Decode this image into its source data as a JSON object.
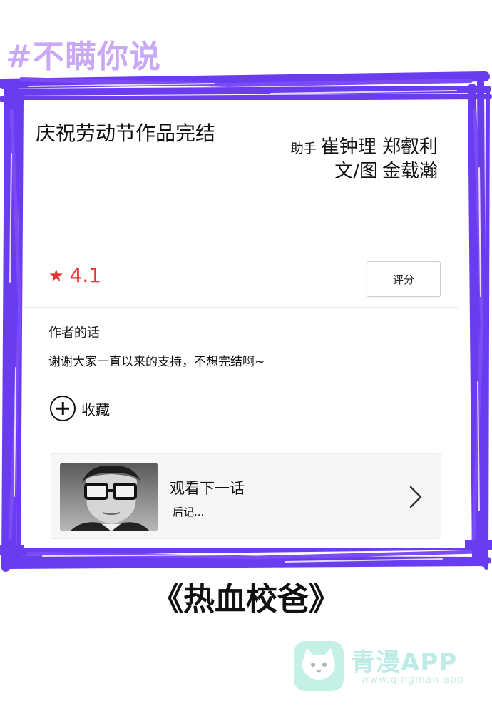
{
  "hashtag": "#不瞒你说",
  "episode_card": {
    "title": "庆祝劳动节作品完结",
    "credits": [
      {
        "role": "助手",
        "names": "崔钟理 郑叡利"
      },
      {
        "role": "文/图",
        "names": "金载瀚"
      }
    ],
    "rating": {
      "icon": "star-icon",
      "value": "4.1"
    },
    "rate_button_label": "评分",
    "author_heading": "作者的话",
    "author_note": "谢谢大家一直以来的支持，不想完结啊~",
    "favorite_label": "收藏",
    "next_episode": {
      "title": "观看下一话",
      "subtitle": "后记..."
    }
  },
  "series_title": "《热血校爸》",
  "watermark": {
    "app_name": "青漫APP",
    "url": "www.qingman.app"
  },
  "colors": {
    "frame": "#6a3cf0",
    "hashtag": "#c9a9f5",
    "rating": "#e3342f",
    "watermark": "#6fd3c8"
  }
}
